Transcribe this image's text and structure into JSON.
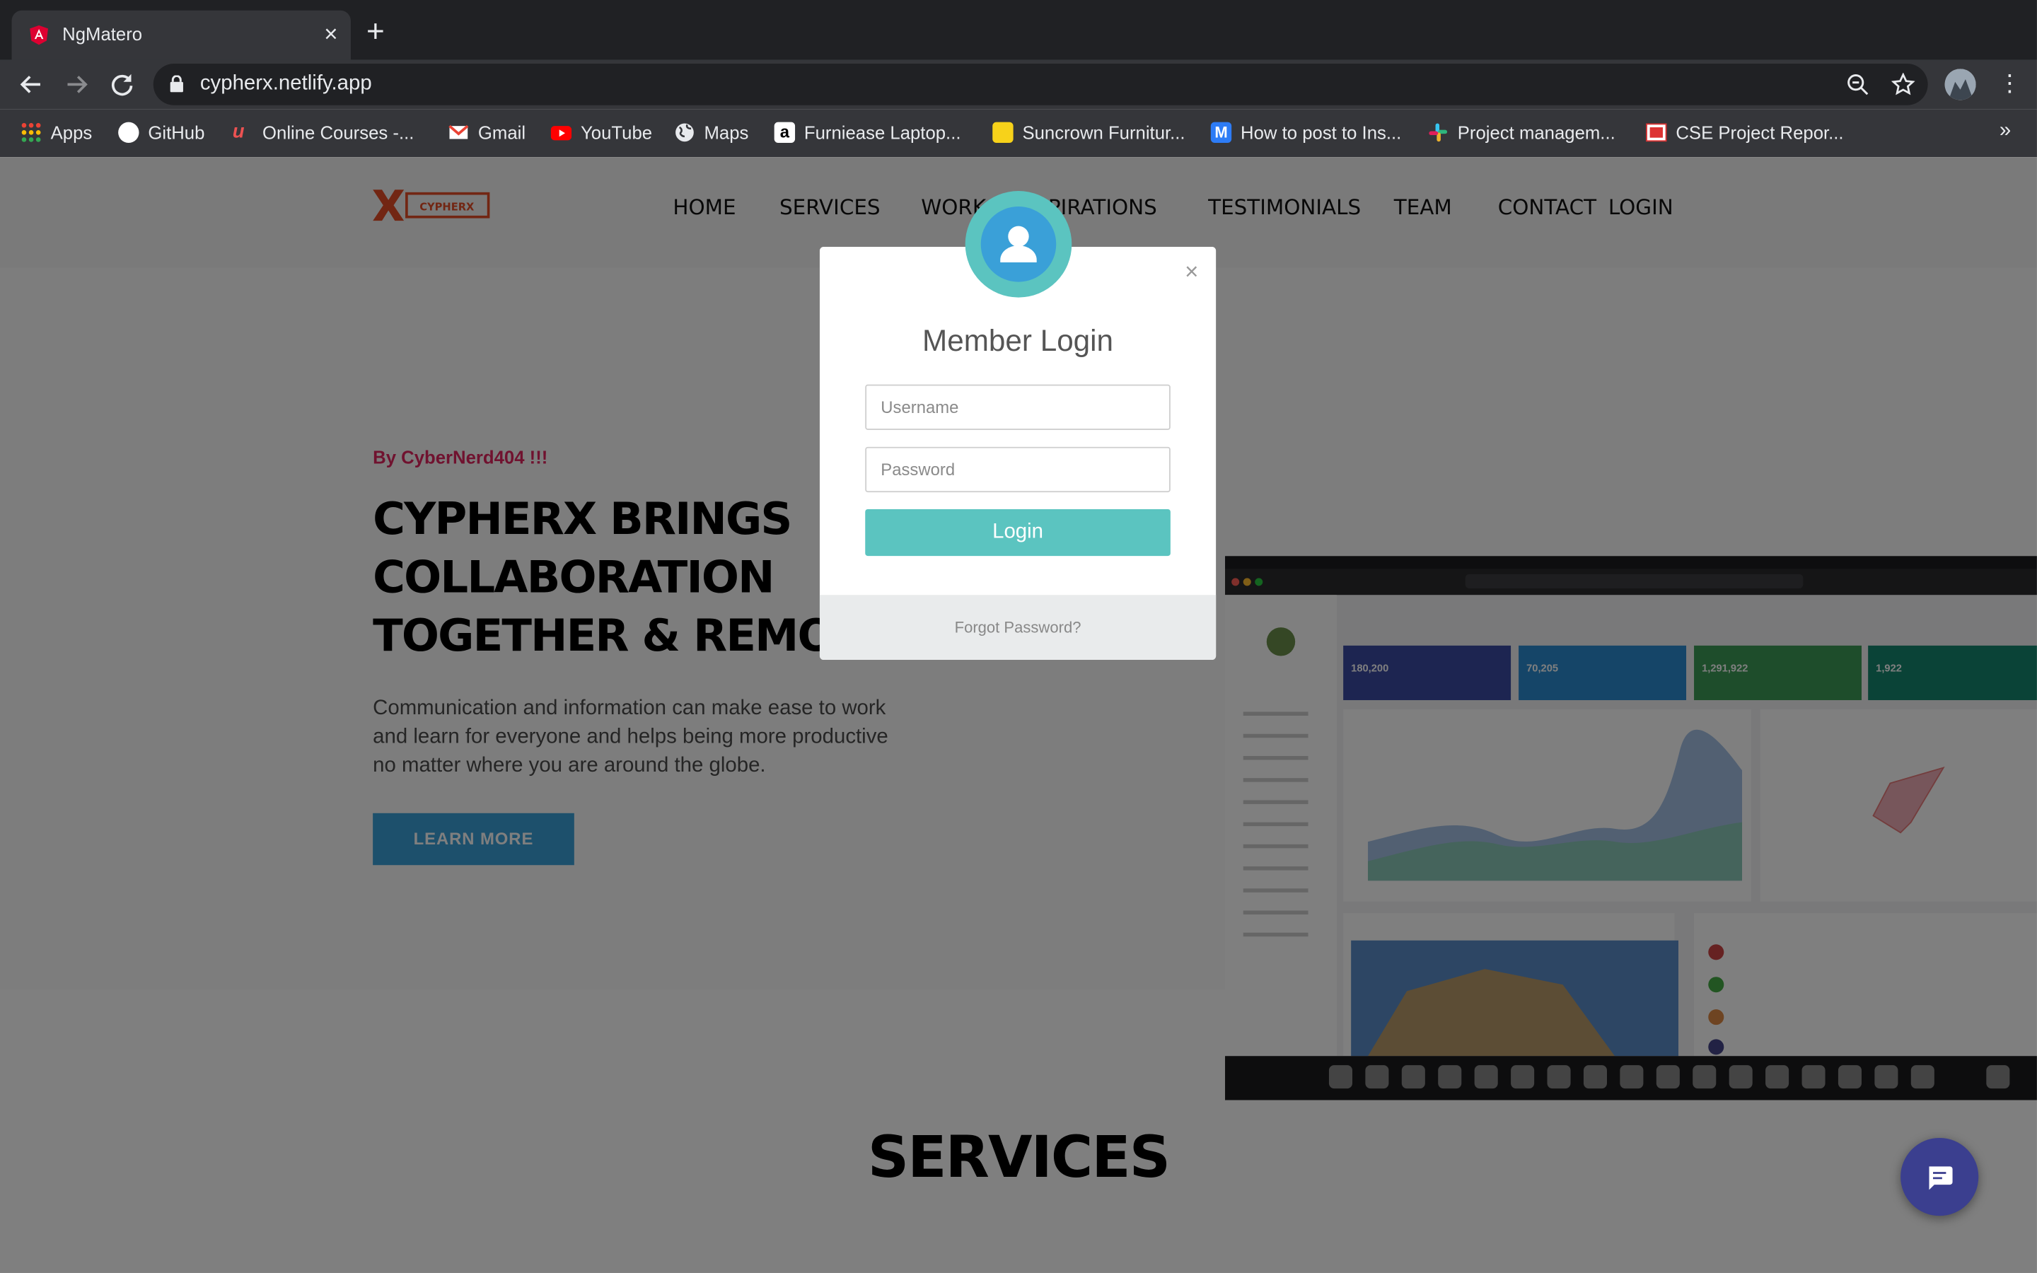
{
  "browser": {
    "tab_title": "NgMatero",
    "url": "cypherx.netlify.app",
    "bookmarks": [
      {
        "label": "Apps",
        "icon": "apps-grid-icon",
        "color": "#e84a4a"
      },
      {
        "label": "GitHub",
        "icon": "github-icon",
        "color": "#ffffff"
      },
      {
        "label": "Online Courses -...",
        "icon": "udemy-icon",
        "color": "#ec5252"
      },
      {
        "label": "Gmail",
        "icon": "gmail-icon",
        "color": "#ea4335"
      },
      {
        "label": "YouTube",
        "icon": "youtube-icon",
        "color": "#ff0000"
      },
      {
        "label": "Maps",
        "icon": "globe-icon",
        "color": "#e8eaed"
      },
      {
        "label": "Furniease Laptop...",
        "icon": "amazon-icon",
        "color": "#ffffff"
      },
      {
        "label": "Suncrown Furnitur...",
        "icon": "flipkart-icon",
        "color": "#f7d21a"
      },
      {
        "label": "How to post to Ins...",
        "icon": "medium-icon",
        "color": "#2d7cf6"
      },
      {
        "label": "Project managem...",
        "icon": "slack-icon",
        "color": "#36c5f0"
      },
      {
        "label": "CSE Project Repor...",
        "icon": "slides-icon",
        "color": "#d33"
      }
    ],
    "more_label": "»"
  },
  "header": {
    "logo_text": "CYPHERX",
    "nav": [
      "HOME",
      "SERVICES",
      "WORK",
      "INSPIRATIONS",
      "TESTIMONIALS",
      "TEAM",
      "CONTACT",
      "LOGIN"
    ]
  },
  "hero": {
    "kicker": "By CyberNerd404 !!!",
    "headline_lines": [
      "CYPHERX BRINGS",
      "COLLABORATION",
      "TOGETHER & REMOTELY"
    ],
    "lead": "Communication and information can make ease to work and learn for everyone and helps being more productive no matter where you are around the globe.",
    "button": "LEARN MORE",
    "screenshot_stats": [
      "180,200",
      "70,205",
      "1,291,922",
      "1,922"
    ],
    "screenshot_stat_colors": [
      "#3b4aa3",
      "#2a8bd0",
      "#3d9b56",
      "#14876f"
    ]
  },
  "services": {
    "title": "SERVICES"
  },
  "modal": {
    "title": "Member Login",
    "username_placeholder": "Username",
    "password_placeholder": "Password",
    "login_label": "Login",
    "forgot_label": "Forgot Password?",
    "close_label": "×",
    "accent": "#5bc4c0"
  }
}
